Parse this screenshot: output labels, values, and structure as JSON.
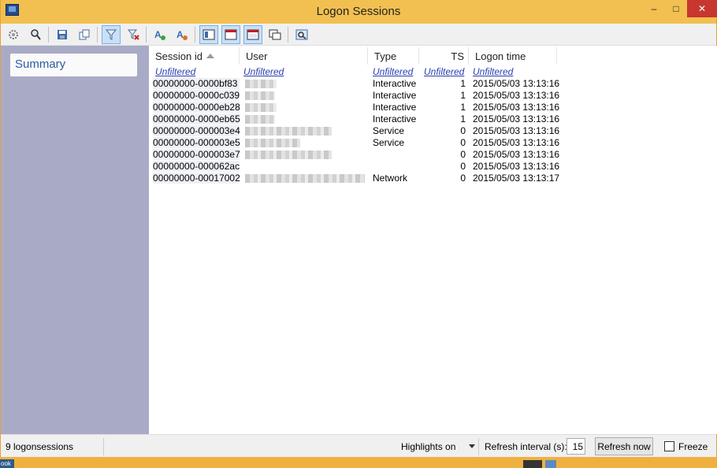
{
  "window": {
    "title": "Logon Sessions"
  },
  "title_buttons": {
    "minimize": "–",
    "maximize": "□",
    "close": "✕"
  },
  "sidebar": {
    "items": [
      {
        "label": "Summary"
      }
    ]
  },
  "table": {
    "columns": [
      {
        "label": "Session id",
        "filter": "Unfiltered"
      },
      {
        "label": "User",
        "filter": "Unfiltered"
      },
      {
        "label": "Type",
        "filter": "Unfiltered"
      },
      {
        "label": "TS",
        "filter": "Unfiltered"
      },
      {
        "label": "Logon time",
        "filter": "Unfiltered"
      }
    ],
    "rows": [
      {
        "session_id": "00000000-0000bf83",
        "type": "Interactive",
        "ts": "1",
        "logon_time": "2015/05/03 13:13:16"
      },
      {
        "session_id": "00000000-0000c039",
        "type": "Interactive",
        "ts": "1",
        "logon_time": "2015/05/03 13:13:16"
      },
      {
        "session_id": "00000000-0000eb28",
        "type": "Interactive",
        "ts": "1",
        "logon_time": "2015/05/03 13:13:16"
      },
      {
        "session_id": "00000000-0000eb65",
        "type": "Interactive",
        "ts": "1",
        "logon_time": "2015/05/03 13:13:16"
      },
      {
        "session_id": "00000000-000003e4",
        "type": "Service",
        "ts": "0",
        "logon_time": "2015/05/03 13:13:16"
      },
      {
        "session_id": "00000000-000003e5",
        "type": "Service",
        "ts": "0",
        "logon_time": "2015/05/03 13:13:16"
      },
      {
        "session_id": "00000000-000003e7",
        "type": "",
        "ts": "0",
        "logon_time": "2015/05/03 13:13:16"
      },
      {
        "session_id": "00000000-000062ac",
        "type": "",
        "ts": "0",
        "logon_time": "2015/05/03 13:13:16"
      },
      {
        "session_id": "00000000-00017002",
        "type": "Network",
        "ts": "0",
        "logon_time": "2015/05/03 13:13:17"
      }
    ]
  },
  "statusbar": {
    "count": "9 logonsessions",
    "highlights": "Highlights on",
    "refresh_label": "Refresh interval (s):",
    "refresh_value": "15",
    "refresh_button": "Refresh now",
    "freeze_label": "Freeze"
  },
  "taskbar": {
    "snippet": "ook"
  },
  "icons": [
    "settings-icon",
    "find-icon",
    "save-icon",
    "copy-icon",
    "filter-icon",
    "clear-filter-icon",
    "highlight-add-icon",
    "highlight-remove-icon",
    "view-split-icon",
    "view-top-icon",
    "view-window-icon",
    "view-cascade-icon",
    "screenshot-icon"
  ]
}
